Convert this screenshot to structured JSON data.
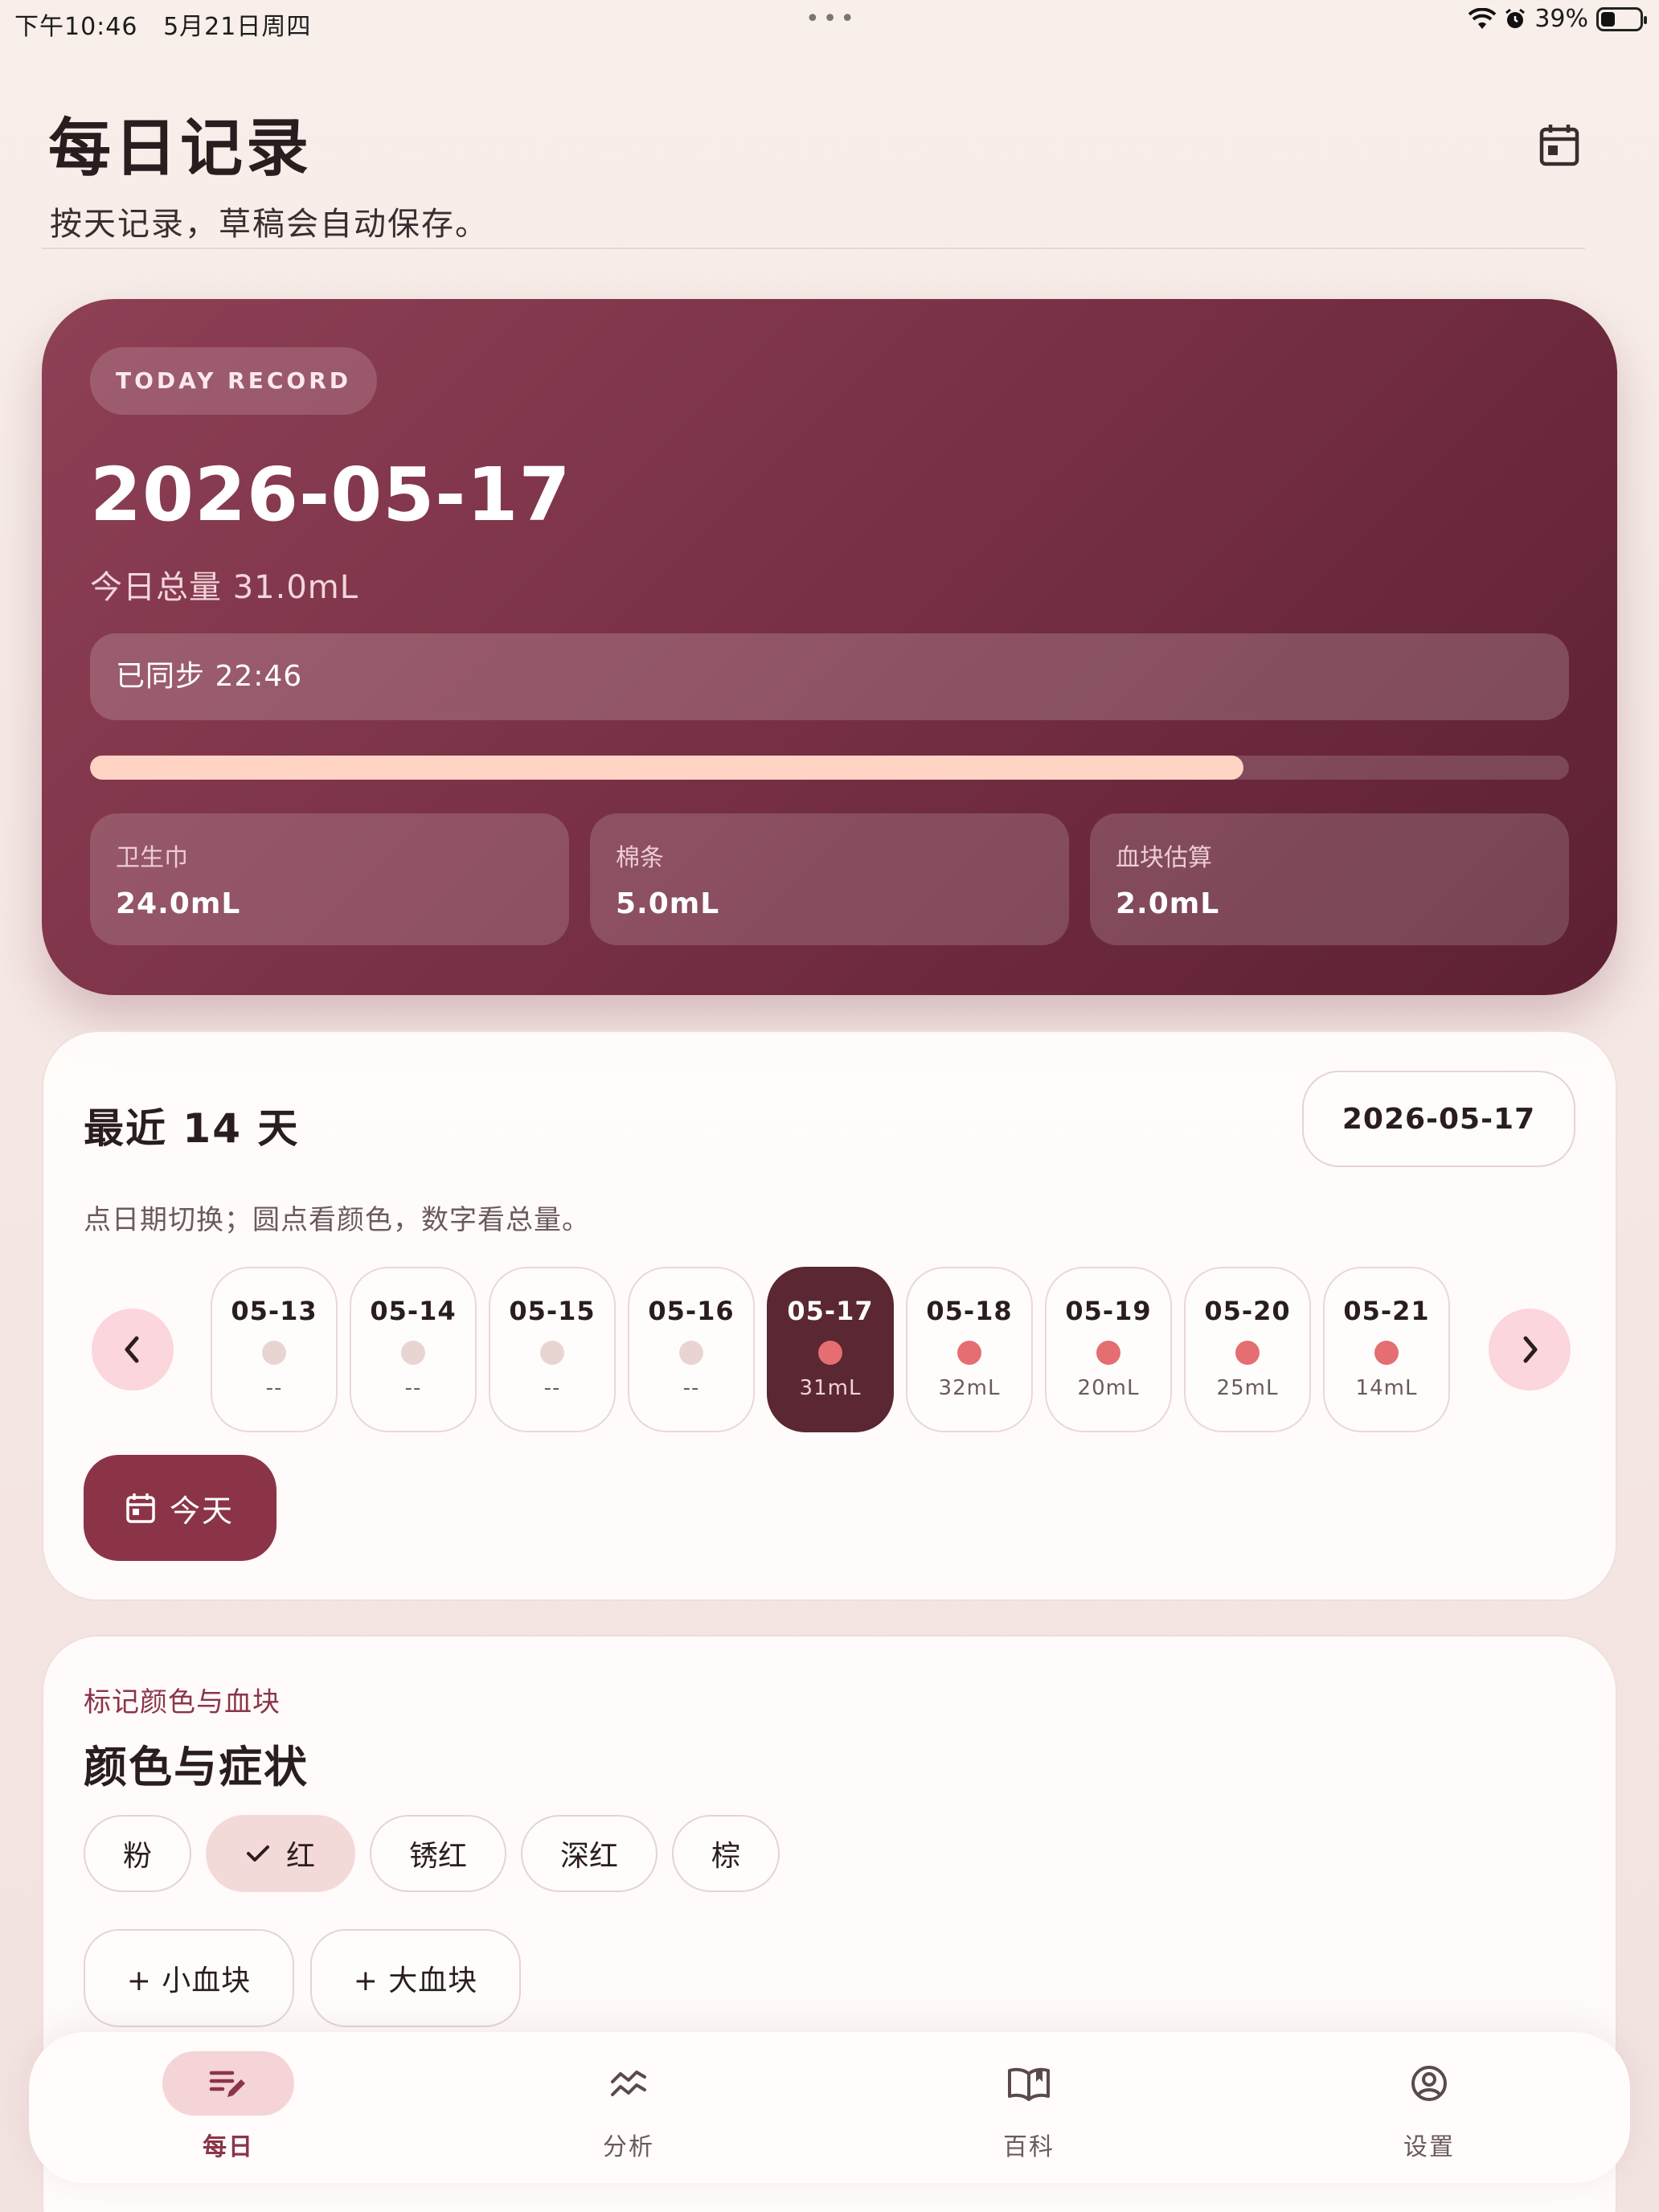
{
  "status_bar": {
    "time": "下午10:46",
    "date": "5月21日周四",
    "dots": "•••",
    "battery": "39%"
  },
  "header": {
    "title": "每日记录",
    "subtitle": "按天记录，草稿会自动保存。"
  },
  "hero": {
    "pill": "TODAY RECORD",
    "date": "2026-05-17",
    "total": "今日总量 31.0mL",
    "sync": "已同步 22:46",
    "progress_fraction": 0.78,
    "stats": [
      {
        "label": "卫生巾",
        "value": "24.0mL"
      },
      {
        "label": "棉条",
        "value": "5.0mL"
      },
      {
        "label": "血块估算",
        "value": "2.0mL"
      }
    ]
  },
  "recent": {
    "title": "最近 14 天",
    "selected_date": "2026-05-17",
    "hint": "点日期切换；圆点看颜色，数字看总量。",
    "days": [
      {
        "date": "05-13",
        "amount": "--",
        "has_data": false
      },
      {
        "date": "05-14",
        "amount": "--",
        "has_data": false
      },
      {
        "date": "05-15",
        "amount": "--",
        "has_data": false
      },
      {
        "date": "05-16",
        "amount": "--",
        "has_data": false
      },
      {
        "date": "05-17",
        "amount": "31mL",
        "has_data": true,
        "selected": true
      },
      {
        "date": "05-18",
        "amount": "32mL",
        "has_data": true
      },
      {
        "date": "05-19",
        "amount": "20mL",
        "has_data": true
      },
      {
        "date": "05-20",
        "amount": "25mL",
        "has_data": true
      },
      {
        "date": "05-21",
        "amount": "14mL",
        "has_data": true
      }
    ],
    "today_button": "今天"
  },
  "color_section": {
    "kicker": "标记颜色与血块",
    "title": "颜色与症状",
    "colors": [
      {
        "label": "粉",
        "selected": false
      },
      {
        "label": "红",
        "selected": true
      },
      {
        "label": "锈红",
        "selected": false
      },
      {
        "label": "深红",
        "selected": false
      },
      {
        "label": "棕",
        "selected": false
      }
    ],
    "clot_buttons": [
      "+ 小血块",
      "+ 大血块"
    ]
  },
  "tabs": [
    {
      "label": "每日",
      "icon": "edit-list-icon",
      "active": true
    },
    {
      "label": "分析",
      "icon": "trend-icon",
      "active": false
    },
    {
      "label": "百科",
      "icon": "book-icon",
      "active": false
    },
    {
      "label": "设置",
      "icon": "user-circle-icon",
      "active": false
    }
  ],
  "colors": {
    "primary": "#8b3448",
    "selected_day": "#5a2732",
    "dot_filled": "#e46e72",
    "dot_empty": "#e8d5d2",
    "progress": "#ffd4c4"
  }
}
